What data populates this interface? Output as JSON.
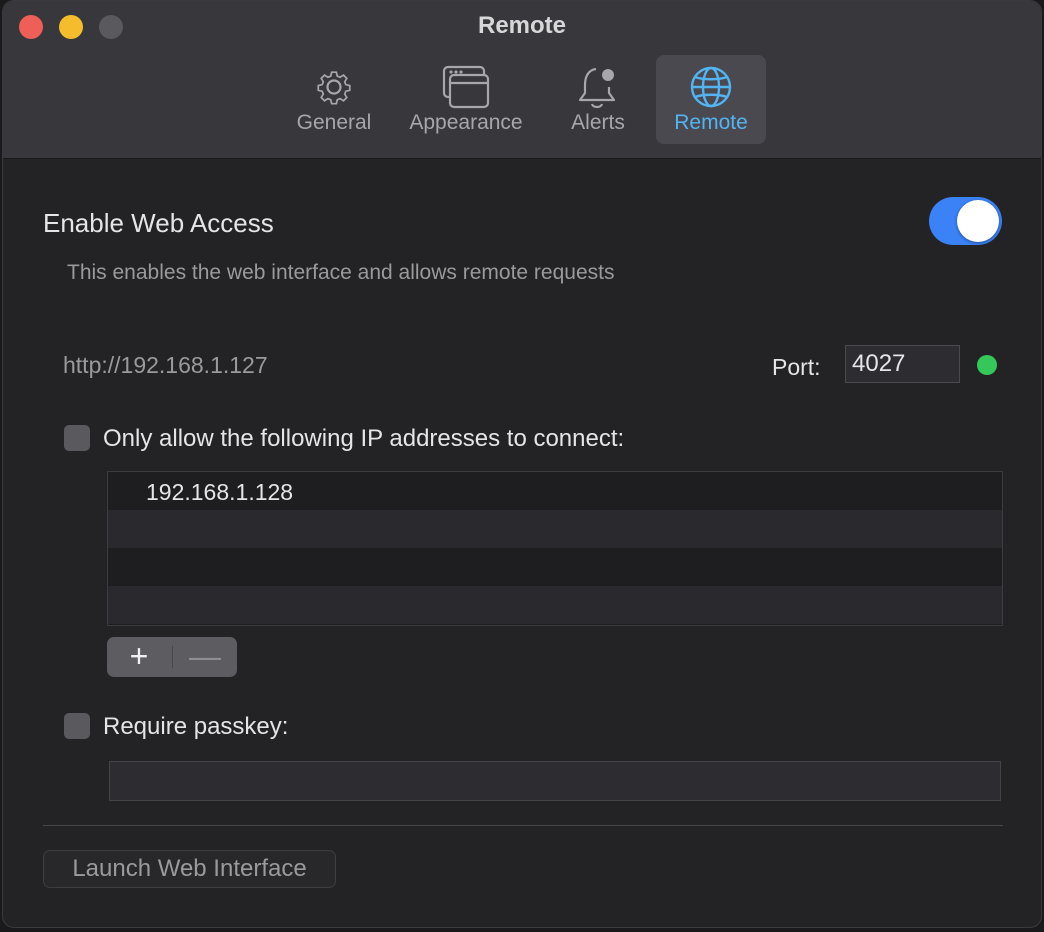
{
  "window": {
    "title": "Remote"
  },
  "tabs": [
    {
      "label": "General",
      "icon": "gear-icon"
    },
    {
      "label": "Appearance",
      "icon": "window-icon"
    },
    {
      "label": "Alerts",
      "icon": "bell-icon"
    },
    {
      "label": "Remote",
      "icon": "globe-icon",
      "active": true
    }
  ],
  "web_access": {
    "title": "Enable Web Access",
    "description": "This enables the web interface and allows remote requests",
    "enabled": true,
    "url": "http://192.168.1.127",
    "port_label": "Port:",
    "port_value": "4027",
    "status_color": "#35c759"
  },
  "ip_filter": {
    "label": "Only allow the following IP addresses to connect:",
    "checked": false,
    "addresses": [
      "192.168.1.128"
    ],
    "add_label": "+",
    "remove_label": "—"
  },
  "passkey": {
    "label": "Require passkey:",
    "checked": false,
    "value": ""
  },
  "launch_button": "Launch Web Interface",
  "colors": {
    "accent": "#3b82f6",
    "active_tab_text": "#54b3f1"
  }
}
